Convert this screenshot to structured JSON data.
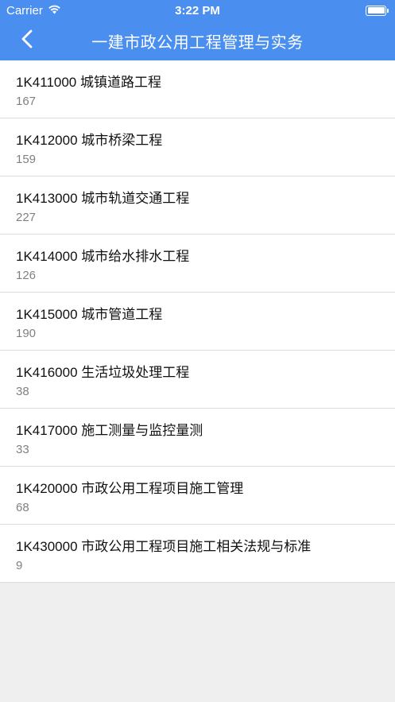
{
  "status": {
    "carrier": "Carrier",
    "time": "3:22 PM"
  },
  "nav": {
    "title": "一建市政公用工程管理与实务",
    "back_icon": "chevron-left-icon"
  },
  "colors": {
    "header_bg": "#4a8ff0",
    "background": "#efefef"
  },
  "items": [
    {
      "title": "1K411000 城镇道路工程",
      "count": "167"
    },
    {
      "title": "1K412000 城市桥梁工程",
      "count": "159"
    },
    {
      "title": "1K413000 城市轨道交通工程",
      "count": "227"
    },
    {
      "title": "1K414000 城市给水排水工程",
      "count": "126"
    },
    {
      "title": "1K415000 城市管道工程",
      "count": "190"
    },
    {
      "title": "1K416000 生活垃圾处理工程",
      "count": "38"
    },
    {
      "title": "1K417000 施工测量与监控量测",
      "count": "33"
    },
    {
      "title": "1K420000 市政公用工程项目施工管理",
      "count": "68"
    },
    {
      "title": "1K430000 市政公用工程项目施工相关法规与标准",
      "count": "9"
    }
  ]
}
